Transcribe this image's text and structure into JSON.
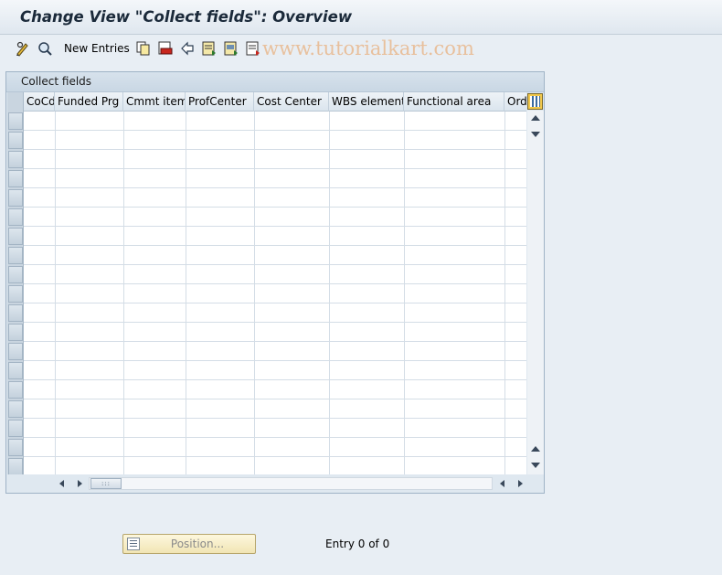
{
  "window": {
    "title": "Change View \"Collect fields\": Overview"
  },
  "toolbar": {
    "new_entries_label": "New Entries",
    "icons": [
      "display-change-icon",
      "details-icon",
      "copy-icon",
      "delete-icon",
      "undo-icon",
      "select-all-icon",
      "select-block-icon",
      "deselect-all-icon"
    ],
    "watermark": "www.tutorialkart.com"
  },
  "table": {
    "title": "Collect fields",
    "columns": [
      "CoCd",
      "Funded Prg",
      "Cmmt item",
      "ProfCenter",
      "Cost Center",
      "WBS element",
      "Functional area",
      "Order"
    ],
    "visible_rows": 19,
    "rows": []
  },
  "footer": {
    "position_button_label": "Position...",
    "entry_text": "Entry 0 of 0"
  },
  "colors": {
    "background": "#e8eef4",
    "header_accent": "#1b2a3a",
    "position_button": "#f1e5b4"
  }
}
